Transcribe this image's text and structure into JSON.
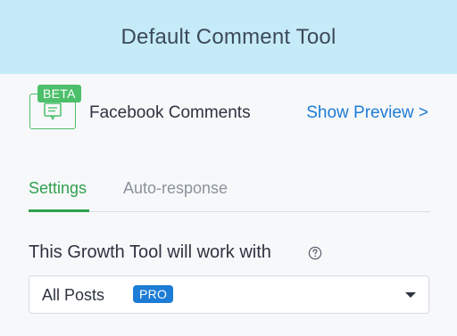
{
  "header": {
    "title": "Default Comment Tool"
  },
  "tool": {
    "icon": "chat-bubble-icon",
    "badge": "BETA",
    "name": "Facebook Comments",
    "preview_link": "Show Preview >"
  },
  "tabs": [
    {
      "label": "Settings",
      "active": true
    },
    {
      "label": "Auto-response",
      "active": false
    }
  ],
  "settings": {
    "works_with_label": "This Growth Tool will work with",
    "help_icon": "question-circle-icon",
    "select": {
      "value": "All Posts",
      "badge": "PRO"
    }
  },
  "colors": {
    "header_bg": "#c6ebf8",
    "accent_green": "#4cbf6a",
    "tab_active": "#2fa04f",
    "link_blue": "#1d7cd6"
  }
}
